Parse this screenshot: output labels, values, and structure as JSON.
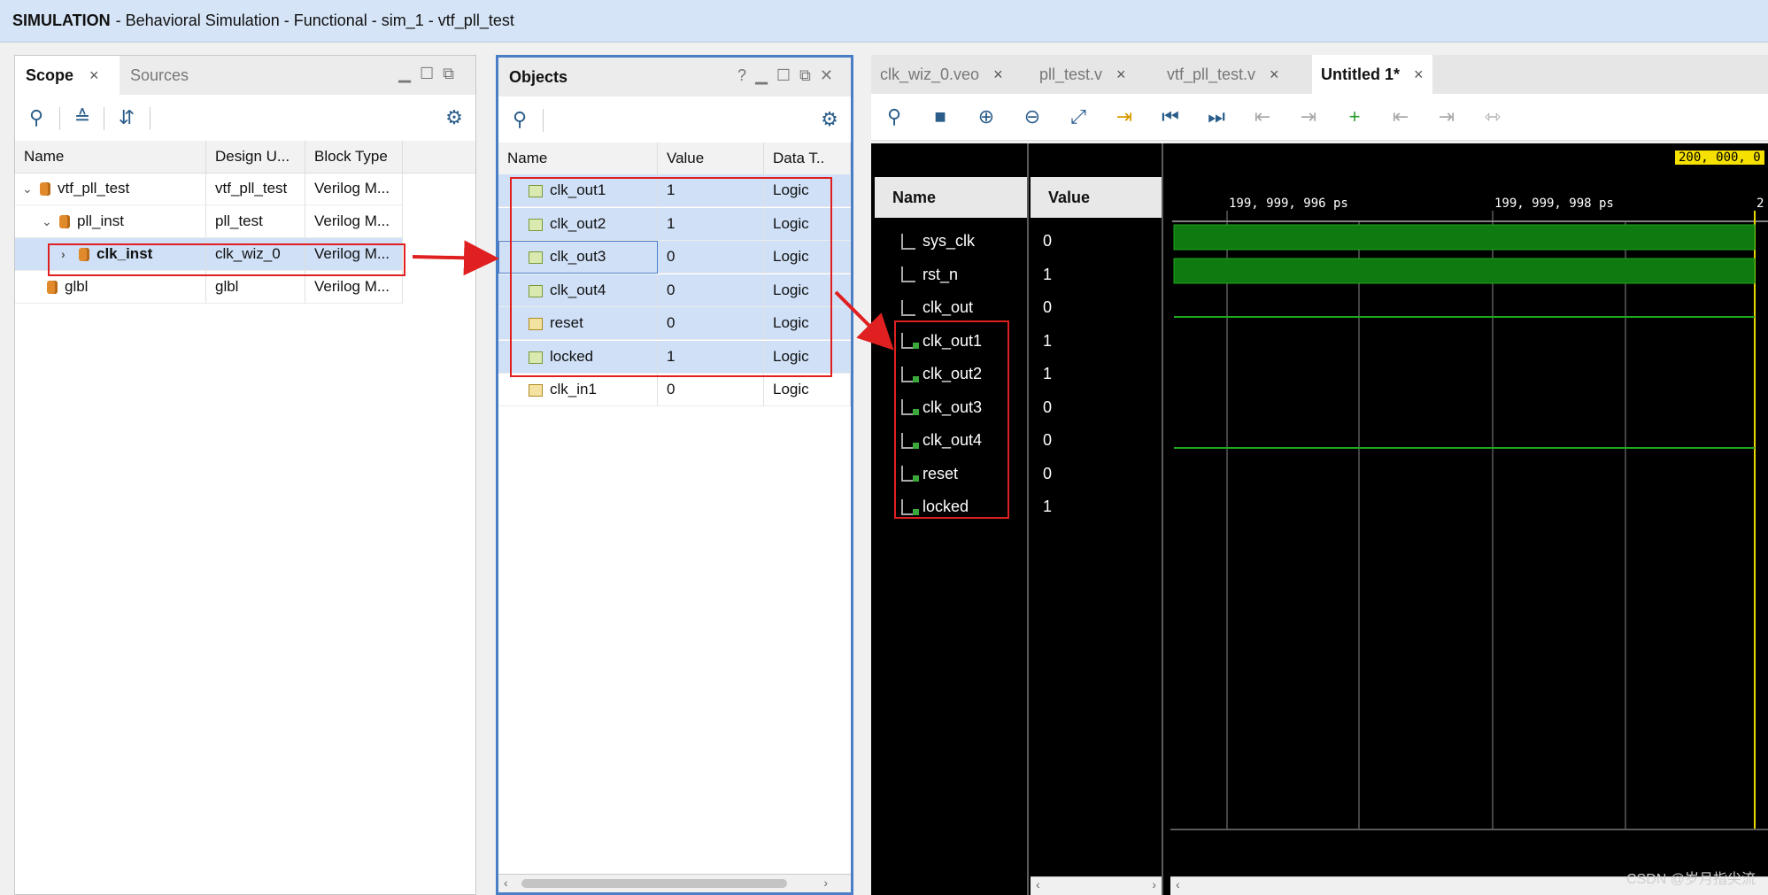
{
  "title": {
    "prefix": "SIMULATION",
    "rest": "- Behavioral Simulation - Functional - sim_1 - vtf_pll_test"
  },
  "scope_panel": {
    "tabs": [
      {
        "label": "Scope",
        "close": "×"
      },
      {
        "label": "Sources"
      }
    ],
    "columns": [
      "Name",
      "Design U...",
      "Block Type"
    ],
    "rows": [
      {
        "name": "vtf_pll_test",
        "design": "vtf_pll_test",
        "block": "Verilog M...",
        "expander": "⌄"
      },
      {
        "name": "pll_inst",
        "design": "pll_test",
        "block": "Verilog M...",
        "expander": "⌄"
      },
      {
        "name": "clk_inst",
        "design": "clk_wiz_0",
        "block": "Verilog M...",
        "expander": "›"
      },
      {
        "name": "glbl",
        "design": "glbl",
        "block": "Verilog M...",
        "expander": ""
      }
    ]
  },
  "objects_panel": {
    "title": "Objects",
    "help": "?",
    "columns": [
      "Name",
      "Value",
      "Data T.."
    ],
    "rows": [
      {
        "name": "clk_out1",
        "value": "1",
        "type": "Logic"
      },
      {
        "name": "clk_out2",
        "value": "1",
        "type": "Logic"
      },
      {
        "name": "clk_out3",
        "value": "0",
        "type": "Logic"
      },
      {
        "name": "clk_out4",
        "value": "0",
        "type": "Logic"
      },
      {
        "name": "reset",
        "value": "0",
        "type": "Logic"
      },
      {
        "name": "locked",
        "value": "1",
        "type": "Logic"
      },
      {
        "name": "clk_in1",
        "value": "0",
        "type": "Logic"
      }
    ]
  },
  "wave_panel": {
    "tabs": [
      {
        "label": "clk_wiz_0.veo",
        "close": "×"
      },
      {
        "label": "pll_test.v",
        "close": "×"
      },
      {
        "label": "vtf_pll_test.v",
        "close": "×"
      },
      {
        "label": "Untitled 1*",
        "close": "×"
      }
    ],
    "name_header": "Name",
    "value_header": "Value",
    "signals": [
      {
        "name": "sys_clk",
        "value": "0"
      },
      {
        "name": "rst_n",
        "value": "1"
      },
      {
        "name": "clk_out",
        "value": "0"
      },
      {
        "name": "clk_out1",
        "value": "1"
      },
      {
        "name": "clk_out2",
        "value": "1"
      },
      {
        "name": "clk_out3",
        "value": "0"
      },
      {
        "name": "clk_out4",
        "value": "0"
      },
      {
        "name": "reset",
        "value": "0"
      },
      {
        "name": "locked",
        "value": "1"
      }
    ],
    "time_labels": [
      "199, 999, 996 ps",
      "199, 999, 998 ps",
      "2"
    ],
    "cursor_time": "200, 000, 0"
  },
  "watermark": "CSDN @岁月指尖流",
  "colors": {
    "accent": "#2a5d8a",
    "highlight": "#e02020",
    "wave": "#1fa51f",
    "cursor": "#f5e000"
  }
}
